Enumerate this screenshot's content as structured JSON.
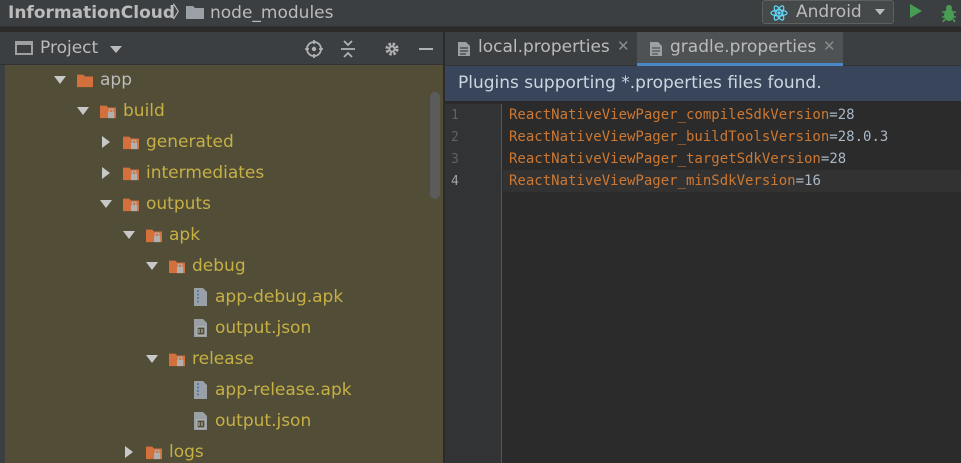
{
  "navbar": {
    "project_name": "InformationCloud",
    "separator": "〉",
    "current_folder": "node_modules",
    "run_config": "Android"
  },
  "project_panel": {
    "title": "Project",
    "header_icons": [
      "locate-icon",
      "collapse-all-icon",
      "gear-icon",
      "minimize-icon"
    ],
    "tree": [
      {
        "label": "app",
        "kind": "module",
        "expanded": true,
        "depth": 0
      },
      {
        "label": "build",
        "kind": "excluded-folder",
        "expanded": true,
        "depth": 1
      },
      {
        "label": "generated",
        "kind": "excluded-folder",
        "expanded": false,
        "depth": 2
      },
      {
        "label": "intermediates",
        "kind": "excluded-folder",
        "expanded": false,
        "depth": 2
      },
      {
        "label": "outputs",
        "kind": "excluded-folder",
        "expanded": true,
        "depth": 2
      },
      {
        "label": "apk",
        "kind": "excluded-folder",
        "expanded": true,
        "depth": 3
      },
      {
        "label": "debug",
        "kind": "excluded-folder",
        "expanded": true,
        "depth": 4
      },
      {
        "label": "app-debug.apk",
        "kind": "apk-file",
        "depth": 5
      },
      {
        "label": "output.json",
        "kind": "json-file",
        "depth": 5
      },
      {
        "label": "release",
        "kind": "excluded-folder",
        "expanded": true,
        "depth": 4
      },
      {
        "label": "app-release.apk",
        "kind": "apk-file",
        "depth": 5
      },
      {
        "label": "output.json",
        "kind": "json-file",
        "depth": 5
      },
      {
        "label": "logs",
        "kind": "excluded-folder",
        "expanded": false,
        "depth": 3
      }
    ]
  },
  "editor": {
    "tabs": [
      {
        "label": "local.properties",
        "active": false
      },
      {
        "label": "gradle.properties",
        "active": true
      }
    ],
    "notice": "Plugins supporting *.properties files found.",
    "lines": [
      {
        "num": "1",
        "key": "ReactNativeViewPager_compileSdkVersion",
        "value": "28"
      },
      {
        "num": "2",
        "key": "ReactNativeViewPager_buildToolsVersion",
        "value": "28.0.3"
      },
      {
        "num": "3",
        "key": "ReactNativeViewPager_targetSdkVersion",
        "value": "28"
      },
      {
        "num": "4",
        "key": "ReactNativeViewPager_minSdkVersion",
        "value": "16"
      }
    ],
    "current_line": 4
  },
  "colors": {
    "excluded_text": "#c6b046",
    "folder_orange": "#d4703c",
    "property_key": "#cc7832",
    "tab_underline": "#4a88c7",
    "notice_bg": "#38455a"
  }
}
